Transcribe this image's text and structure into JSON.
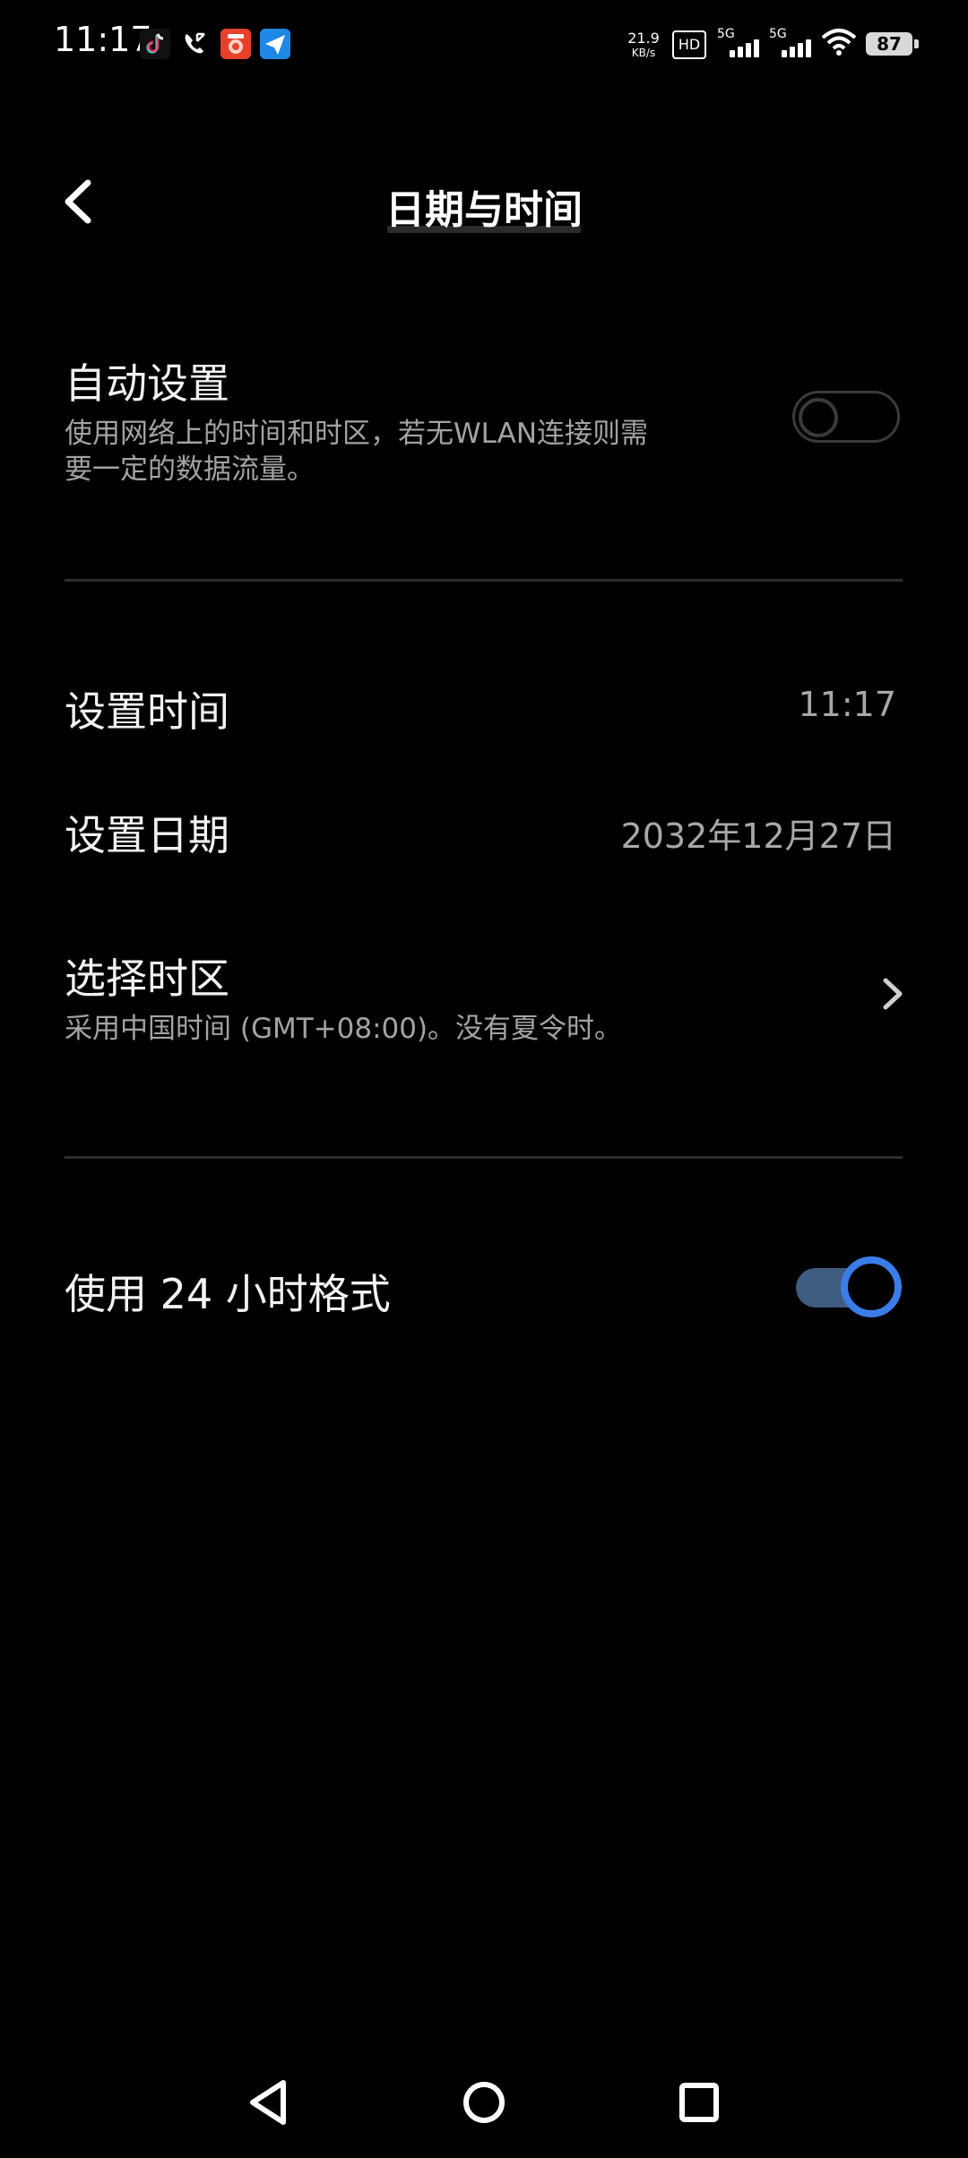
{
  "status_bar": {
    "time": "11:17",
    "network_speed_value": "21.9",
    "network_speed_unit": "KB/s",
    "hd_label": "HD",
    "signal_1_label": "5G",
    "signal_2_label": "5G",
    "battery_level": "87",
    "app_icons": [
      "tiktok-icon",
      "missed-call-icon",
      "red-app-icon",
      "send-app-icon"
    ]
  },
  "header": {
    "title": "日期与时间"
  },
  "settings": {
    "auto_set": {
      "title": "自动设置",
      "description_line1": "使用网络上的时间和时区，若无WLAN连接则需",
      "description_line2": "要一定的数据流量。",
      "enabled": false
    },
    "set_time": {
      "title": "设置时间",
      "value": "11:17"
    },
    "set_date": {
      "title": "设置日期",
      "value": "2032年12月27日"
    },
    "timezone": {
      "title": "选择时区",
      "description": "采用中国时间 (GMT+08:00)。没有夏令时。"
    },
    "use_24h": {
      "title": "使用 24 小时格式",
      "enabled": true
    }
  },
  "colors": {
    "background": "#000000",
    "accent": "#3a7de8",
    "secondary_text": "#a3a3a3"
  },
  "nav_bar": {
    "icons": [
      "back-triangle-icon",
      "home-circle-icon",
      "recents-square-icon"
    ]
  }
}
